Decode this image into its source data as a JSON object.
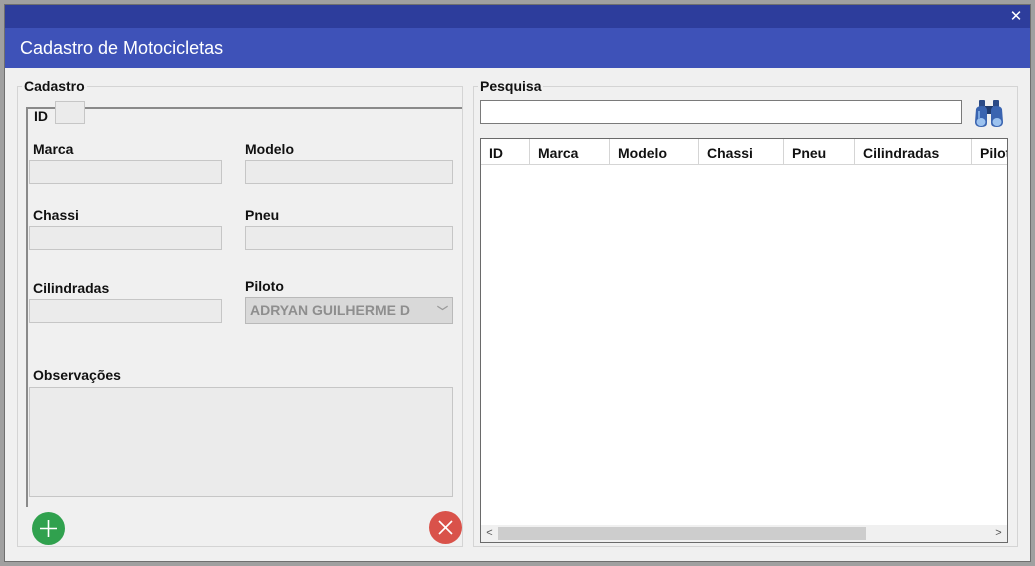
{
  "window": {
    "title": "Cadastro de Motocicletas",
    "close_icon": "close-icon"
  },
  "cadastro": {
    "legend": "Cadastro",
    "id_label": "ID",
    "marca_label": "Marca",
    "modelo_label": "Modelo",
    "chassi_label": "Chassi",
    "pneu_label": "Pneu",
    "cilindradas_label": "Cilindradas",
    "piloto_label": "Piloto",
    "piloto_value": "ADRYAN GUILHERME D",
    "observacoes_label": "Observações",
    "add_icon": "plus-icon",
    "cancel_icon": "x-icon"
  },
  "pesquisa": {
    "legend": "Pesquisa",
    "search_value": "",
    "search_icon": "binoculars-icon",
    "columns": [
      "ID",
      "Marca",
      "Modelo",
      "Chassi",
      "Pneu",
      "Cilindradas",
      "Piloto"
    ],
    "rows": []
  },
  "colors": {
    "topbar": "#2d3d9c",
    "header": "#3e52b8",
    "add_button": "#30a14e",
    "cancel_button": "#d9524a"
  }
}
